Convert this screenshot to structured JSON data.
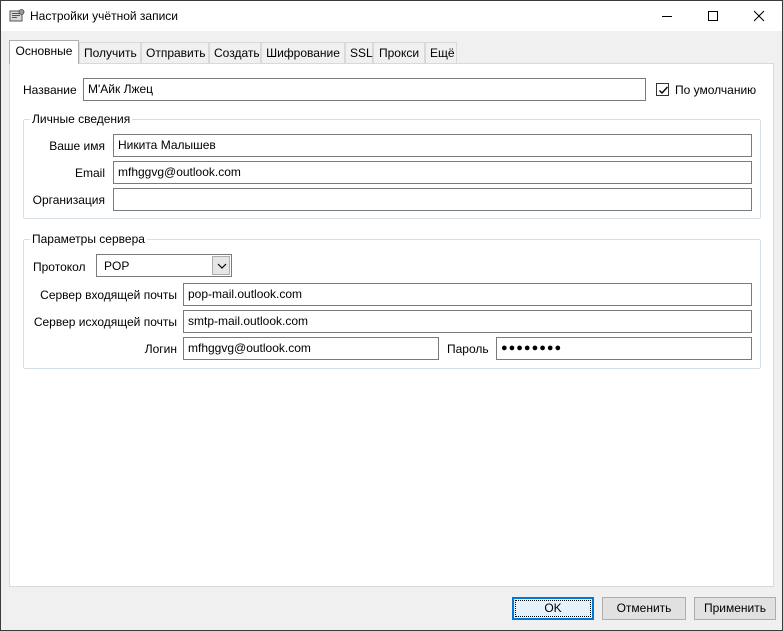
{
  "window": {
    "title": "Настройки учётной записи"
  },
  "tabs": [
    {
      "label": "Основные",
      "active": true
    },
    {
      "label": "Получить"
    },
    {
      "label": "Отправить"
    },
    {
      "label": "Создать"
    },
    {
      "label": "Шифрование"
    },
    {
      "label": "SSL"
    },
    {
      "label": "Прокси"
    },
    {
      "label": "Ещё"
    }
  ],
  "general": {
    "name_label": "Название",
    "name_value": "М'Айк Лжец",
    "default_label": "По умолчанию",
    "default_checked": true
  },
  "personal": {
    "group_title": "Личные сведения",
    "your_name_label": "Ваше имя",
    "your_name_value": "Никита Малышев",
    "email_label": "Email",
    "email_value": "mfhggvg@outlook.com",
    "org_label": "Организация",
    "org_value": ""
  },
  "server": {
    "group_title": "Параметры сервера",
    "protocol_label": "Протокол",
    "protocol_value": "POP",
    "incoming_label": "Сервер входящей почты",
    "incoming_value": "pop-mail.outlook.com",
    "outgoing_label": "Сервер исходящей почты",
    "outgoing_value": "smtp-mail.outlook.com",
    "login_label": "Логин",
    "login_value": "mfhggvg@outlook.com",
    "password_label": "Пароль",
    "password_value": "●●●●●●●●"
  },
  "buttons": {
    "ok": "OK",
    "cancel": "Отменить",
    "apply": "Применить"
  },
  "colors": {
    "accent": "#0078d7",
    "panel": "#ffffff",
    "window": "#f0f0f0"
  }
}
